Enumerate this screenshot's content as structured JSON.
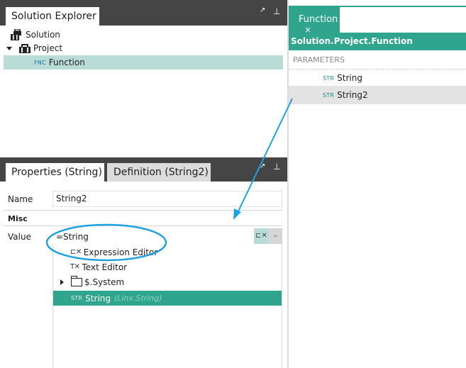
{
  "solution_explorer": {
    "tab_title": "Solution Explorer",
    "pin_glyph": "⇱",
    "pushpin_glyph": "⊥",
    "tree": [
      {
        "label": "Solution",
        "icon": "solution-icon"
      },
      {
        "label": "Project",
        "icon": "project-box-icon",
        "expanded": true
      },
      {
        "tag": "FNC",
        "label": "Function",
        "selected": true
      }
    ]
  },
  "properties_panel": {
    "tab_properties": "Properties (String)",
    "tab_definition": "Definition (String2)",
    "name_label": "Name",
    "name_value": "String2",
    "section_misc": "Misc",
    "value_label": "Value",
    "value_text": "=String",
    "expression_button": "⊏✕",
    "dropdown_arrow": "⌄",
    "dropdown_items": [
      {
        "glyph": "⊏✕",
        "label": "Expression Editor"
      },
      {
        "glyph": "T✕",
        "label": "Text Editor"
      },
      {
        "label": "$.System",
        "icon": "folder-icon"
      },
      {
        "tag": "STR",
        "label": "String",
        "type_hint": "(Linx.String)",
        "selected": true
      }
    ]
  },
  "function_editor": {
    "tab_label": "Function",
    "tab_close": "×",
    "path": "Solution.Project.Function",
    "parameters_header": "PARAMETERS",
    "parameters": [
      {
        "tag": "STR",
        "label": "String"
      },
      {
        "tag": "STR",
        "label": "String2",
        "selected": true
      }
    ]
  },
  "colors": {
    "accent": "#2ea58c",
    "selection": "#b9dcd7",
    "dock_header": "#454545",
    "annotation": "#1ea3e0"
  }
}
